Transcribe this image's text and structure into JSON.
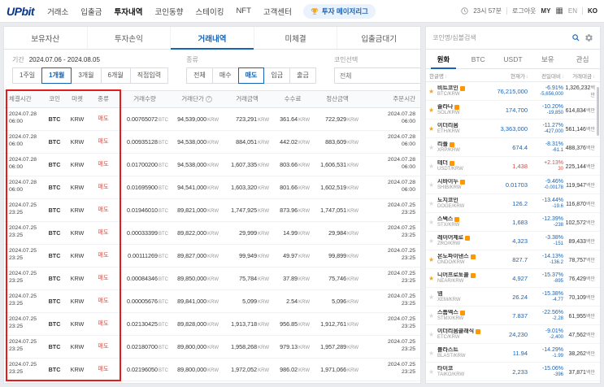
{
  "nav": {
    "logo": "UPbit",
    "items": [
      {
        "label": "거래소",
        "active": false
      },
      {
        "label": "입출금",
        "active": false
      },
      {
        "label": "투자내역",
        "active": true
      },
      {
        "label": "코인동향",
        "active": false
      },
      {
        "label": "스테이킹",
        "active": false
      },
      {
        "label": "NFT",
        "active": false
      },
      {
        "label": "고객센터",
        "active": false
      }
    ],
    "league_label": "투자 메이저리그",
    "time": "23시 57분",
    "logout": "로그아웃",
    "my": "MY",
    "lang_en": "EN",
    "lang_ko": "KO"
  },
  "page_tabs": [
    {
      "label": "보유자산",
      "active": false
    },
    {
      "label": "투자손익",
      "active": false
    },
    {
      "label": "거래내역",
      "active": true
    },
    {
      "label": "미체결",
      "active": false
    },
    {
      "label": "입출금대기",
      "active": false
    }
  ],
  "filters": {
    "period_label": "기간",
    "period_value": "2024.07.06 - 2024.08.05",
    "period_options": [
      {
        "label": "1주일",
        "active": false
      },
      {
        "label": "1개월",
        "active": true
      },
      {
        "label": "3개월",
        "active": false
      },
      {
        "label": "6개월",
        "active": false
      },
      {
        "label": "직접입력",
        "active": false
      }
    ],
    "type_label": "종류",
    "type_options": [
      {
        "label": "전체",
        "active": false
      },
      {
        "label": "매수",
        "active": false
      },
      {
        "label": "매도",
        "active": true
      },
      {
        "label": "입금",
        "active": false
      },
      {
        "label": "출금",
        "active": false
      }
    ],
    "coin_label": "코인선택",
    "coin_placeholder": "전체"
  },
  "table": {
    "headers": [
      "체결시간",
      "코인",
      "마켓",
      "종류",
      "거래수량",
      "거래단가",
      "거래금액",
      "수수료",
      "정산금액",
      "주문시간"
    ],
    "qty_unit": "BTC",
    "krw_unit": "KRW",
    "rows": [
      {
        "exec_date": "2024.07.28",
        "exec_time": "06:00",
        "coin": "BTC",
        "market": "KRW",
        "side": "매도",
        "qty": "0.00765072",
        "price": "94,539,000",
        "amount": "723,291",
        "fee": "361.64",
        "settlement": "722,929",
        "order_date": "2024.07.28",
        "order_time": "06:00"
      },
      {
        "exec_date": "2024.07.28",
        "exec_time": "06:00",
        "coin": "BTC",
        "market": "KRW",
        "side": "매도",
        "qty": "0.00935128",
        "price": "94,538,000",
        "amount": "884,051",
        "fee": "442.02",
        "settlement": "883,609",
        "order_date": "2024.07.28",
        "order_time": "06:00"
      },
      {
        "exec_date": "2024.07.28",
        "exec_time": "06:00",
        "coin": "BTC",
        "market": "KRW",
        "side": "매도",
        "qty": "0.01700200",
        "price": "94,538,000",
        "amount": "1,607,335",
        "fee": "803.66",
        "settlement": "1,606,531",
        "order_date": "2024.07.28",
        "order_time": "06:00"
      },
      {
        "exec_date": "2024.07.28",
        "exec_time": "06:00",
        "coin": "BTC",
        "market": "KRW",
        "side": "매도",
        "qty": "0.01695900",
        "price": "94,541,000",
        "amount": "1,603,320",
        "fee": "801.66",
        "settlement": "1,602,519",
        "order_date": "2024.07.28",
        "order_time": "06:00"
      },
      {
        "exec_date": "2024.07.25",
        "exec_time": "23:25",
        "coin": "BTC",
        "market": "KRW",
        "side": "매도",
        "qty": "0.01946010",
        "price": "89,821,000",
        "amount": "1,747,925",
        "fee": "873.96",
        "settlement": "1,747,051",
        "order_date": "2024.07.25",
        "order_time": "23:25"
      },
      {
        "exec_date": "2024.07.25",
        "exec_time": "23:25",
        "coin": "BTC",
        "market": "KRW",
        "side": "매도",
        "qty": "0.00033399",
        "price": "89,822,000",
        "amount": "29,999",
        "fee": "14.99",
        "settlement": "29,984",
        "order_date": "2024.07.25",
        "order_time": "23:25"
      },
      {
        "exec_date": "2024.07.25",
        "exec_time": "23:25",
        "coin": "BTC",
        "market": "KRW",
        "side": "매도",
        "qty": "0.00111269",
        "price": "89,827,000",
        "amount": "99,949",
        "fee": "49.97",
        "settlement": "99,899",
        "order_date": "2024.07.25",
        "order_time": "23:25"
      },
      {
        "exec_date": "2024.07.25",
        "exec_time": "23:25",
        "coin": "BTC",
        "market": "KRW",
        "side": "매도",
        "qty": "0.00084346",
        "price": "89,850,000",
        "amount": "75,784",
        "fee": "37.89",
        "settlement": "75,746",
        "order_date": "2024.07.25",
        "order_time": "23:25"
      },
      {
        "exec_date": "2024.07.25",
        "exec_time": "23:25",
        "coin": "BTC",
        "market": "KRW",
        "side": "매도",
        "qty": "0.00005676",
        "price": "89,841,000",
        "amount": "5,099",
        "fee": "2.54",
        "settlement": "5,096",
        "order_date": "2024.07.25",
        "order_time": "23:25"
      },
      {
        "exec_date": "2024.07.25",
        "exec_time": "23:25",
        "coin": "BTC",
        "market": "KRW",
        "side": "매도",
        "qty": "0.02130425",
        "price": "89,828,000",
        "amount": "1,913,718",
        "fee": "956.85",
        "settlement": "1,912,761",
        "order_date": "2024.07.25",
        "order_time": "23:25"
      },
      {
        "exec_date": "2024.07.25",
        "exec_time": "23:25",
        "coin": "BTC",
        "market": "KRW",
        "side": "매도",
        "qty": "0.02180700",
        "price": "89,800,000",
        "amount": "1,958,268",
        "fee": "979.13",
        "settlement": "1,957,289",
        "order_date": "2024.07.25",
        "order_time": "23:25"
      },
      {
        "exec_date": "2024.07.25",
        "exec_time": "23:25",
        "coin": "BTC",
        "market": "KRW",
        "side": "매도",
        "qty": "0.02196050",
        "price": "89,800,000",
        "amount": "1,972,052",
        "fee": "986.02",
        "settlement": "1,971,066",
        "order_date": "2024.07.25",
        "order_time": "23:25"
      }
    ]
  },
  "sidebar": {
    "search_placeholder": "코인명/심볼검색",
    "tabs": [
      {
        "label": "원화",
        "active": true
      },
      {
        "label": "BTC",
        "active": false
      },
      {
        "label": "USDT",
        "active": false
      },
      {
        "label": "보유",
        "active": false
      },
      {
        "label": "관심",
        "active": false
      }
    ],
    "col_headers": [
      "한글명",
      "현재가",
      "전일대비",
      "거래대금"
    ],
    "vol_unit": "백만",
    "coins": [
      {
        "fav": true,
        "badge": true,
        "name": "비트코인",
        "pair": "BTC/KRW",
        "price": "76,215,000",
        "pct": "-6.91%",
        "diff": "-5,656,000",
        "vol": "1,326,232",
        "dir": "down"
      },
      {
        "fav": true,
        "badge": true,
        "name": "솔라나",
        "pair": "SOL/KRW",
        "price": "174,700",
        "pct": "-10.20%",
        "diff": "-19,850",
        "vol": "614,834",
        "dir": "down"
      },
      {
        "fav": true,
        "badge": false,
        "name": "이더리움",
        "pair": "ETH/KRW",
        "price": "3,363,000",
        "pct": "-11.27%",
        "diff": "-427,000",
        "vol": "561,146",
        "dir": "down"
      },
      {
        "fav": false,
        "badge": true,
        "name": "리플",
        "pair": "XRP/KRW",
        "price": "674.4",
        "pct": "-8.31%",
        "diff": "-61.1",
        "vol": "488,376",
        "dir": "down"
      },
      {
        "fav": false,
        "badge": true,
        "name": "테더",
        "pair": "USDT/KRW",
        "price": "1,438",
        "pct": "+2.13%",
        "diff": "30",
        "vol": "225,144",
        "dir": "up"
      },
      {
        "fav": false,
        "badge": true,
        "name": "시바이누",
        "pair": "SHIB/KRW",
        "price": "0.01703",
        "pct": "-9.46%",
        "diff": "-0.00178",
        "vol": "119,947",
        "dir": "down"
      },
      {
        "fav": false,
        "badge": false,
        "name": "도지코인",
        "pair": "DOGE/KRW",
        "price": "126.2",
        "pct": "-13.44%",
        "diff": "-19.6",
        "vol": "116,870",
        "dir": "down"
      },
      {
        "fav": false,
        "badge": true,
        "name": "스택스",
        "pair": "STX/KRW",
        "price": "1,683",
        "pct": "-12.39%",
        "diff": "-238",
        "vol": "102,572",
        "dir": "down"
      },
      {
        "fav": false,
        "badge": true,
        "name": "레이어제로",
        "pair": "ZRO/KRW",
        "price": "4,323",
        "pct": "-3.38%",
        "diff": "-151",
        "vol": "89,433",
        "dir": "down"
      },
      {
        "fav": true,
        "badge": true,
        "name": "온도파이낸스",
        "pair": "ONDO/KRW",
        "price": "827.7",
        "pct": "-14.13%",
        "diff": "-136.2",
        "vol": "78,757",
        "dir": "down"
      },
      {
        "fav": true,
        "badge": true,
        "name": "니어프로토콜",
        "pair": "NEAR/KRW",
        "price": "4,927",
        "pct": "-15.37%",
        "diff": "-895",
        "vol": "76,429",
        "dir": "down"
      },
      {
        "fav": false,
        "badge": false,
        "name": "넴",
        "pair": "XEM/KRW",
        "price": "26.24",
        "pct": "-15.38%",
        "diff": "-4.77",
        "vol": "70,109",
        "dir": "down"
      },
      {
        "fav": false,
        "badge": true,
        "name": "스톰엑스",
        "pair": "STMX/KRW",
        "price": "7.837",
        "pct": "-22.56%",
        "diff": "-2.28",
        "vol": "61,955",
        "dir": "down"
      },
      {
        "fav": false,
        "badge": true,
        "name": "이더리움클래식",
        "pair": "ETC/KRW",
        "price": "24,230",
        "pct": "-9.01%",
        "diff": "-2,400",
        "vol": "47,562",
        "dir": "down"
      },
      {
        "fav": false,
        "badge": false,
        "name": "블라스트",
        "pair": "BLAST/KRW",
        "price": "11.94",
        "pct": "-14.29%",
        "diff": "-1.99",
        "vol": "38,262",
        "dir": "down"
      },
      {
        "fav": false,
        "badge": false,
        "name": "타이코",
        "pair": "TAIKO/KRW",
        "price": "2,233",
        "pct": "-15.06%",
        "diff": "-396",
        "vol": "37,871",
        "dir": "down"
      }
    ]
  },
  "colors": {
    "up": "#d24f45",
    "down": "#1763b6",
    "brand": "#093687",
    "accent": "#1763b6",
    "highlight_box": "#e51c1c"
  }
}
